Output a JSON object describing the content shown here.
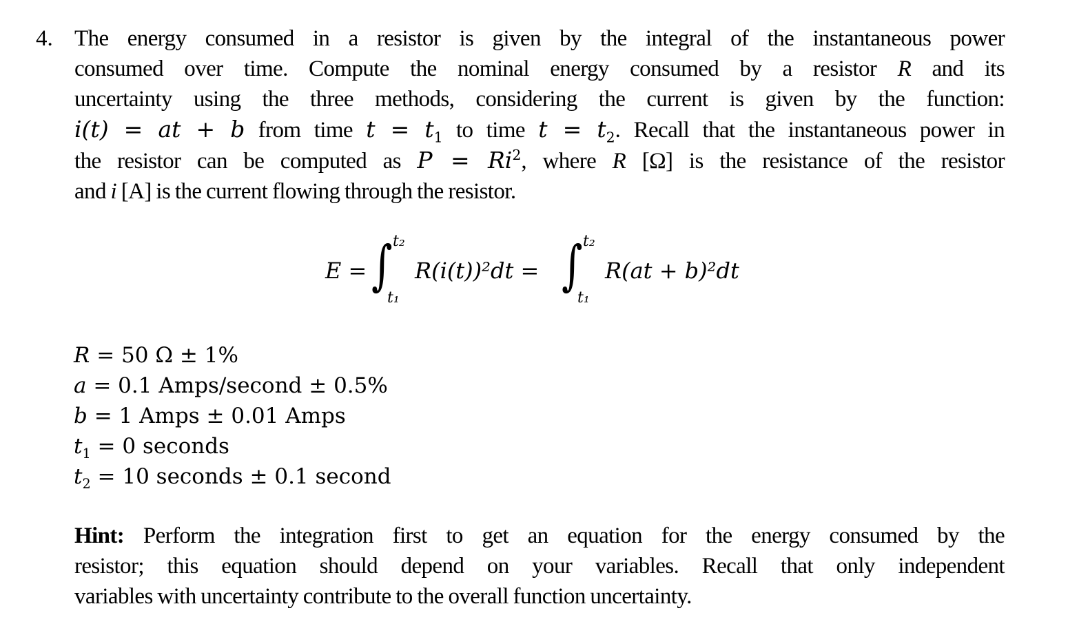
{
  "problem": {
    "number": "4.",
    "lines": [
      "The energy consumed in a resistor is given by the integral of the instantaneous power",
      "consumed over time. Compute the nominal energy consumed by a resistor",
      "and its",
      "uncertainty using the three methods, considering the current is given by the function:"
    ],
    "var_R": "R",
    "line4": {
      "func": "i(t) = at + b",
      "from_text": "from time",
      "t_eq_t1_t": "t = t",
      "sub1": "1",
      "to_text": "to time",
      "t_eq_t2_t": "t = t",
      "sub2": "2",
      "rest": ". Recall that the instantaneous power in"
    },
    "line5": {
      "start": "the resistor can be computed as",
      "P": "P",
      "eq": " = ",
      "Ri": "Ri",
      "sup": "2",
      "mid": ", where",
      "R": "R",
      "unit_R": "[Ω]",
      "end": "is the resistance of the resistor"
    },
    "line6": {
      "start": "and",
      "i": "i",
      "unit_A": "[A]",
      "end": "is the current flowing through the resistor."
    }
  },
  "equation": {
    "lhs": "E =",
    "upper": "t₂",
    "lower": "t₁",
    "integrand1": "R(i(t))²dt =",
    "integrand2": "R(at + b)²dt"
  },
  "variables": [
    {
      "name": "R",
      "sub": "",
      "value": "= 50 Ω ± 1%"
    },
    {
      "name": "a",
      "sub": "",
      "value": "= 0.1 Amps/second ± 0.5%"
    },
    {
      "name": "b",
      "sub": "",
      "value": "= 1 Amps ± 0.01 Amps"
    },
    {
      "name": "t",
      "sub": "1",
      "value": "= 0 seconds"
    },
    {
      "name": "t",
      "sub": "2",
      "value": "= 10 seconds ± 0.1 second"
    }
  ],
  "hint": {
    "label": "Hint:",
    "lines": [
      "Perform the integration first to get an equation for the energy consumed by the",
      "resistor; this equation should depend on your variables.  Recall that only independent",
      "variables with uncertainty contribute to the overall function uncertainty."
    ]
  }
}
